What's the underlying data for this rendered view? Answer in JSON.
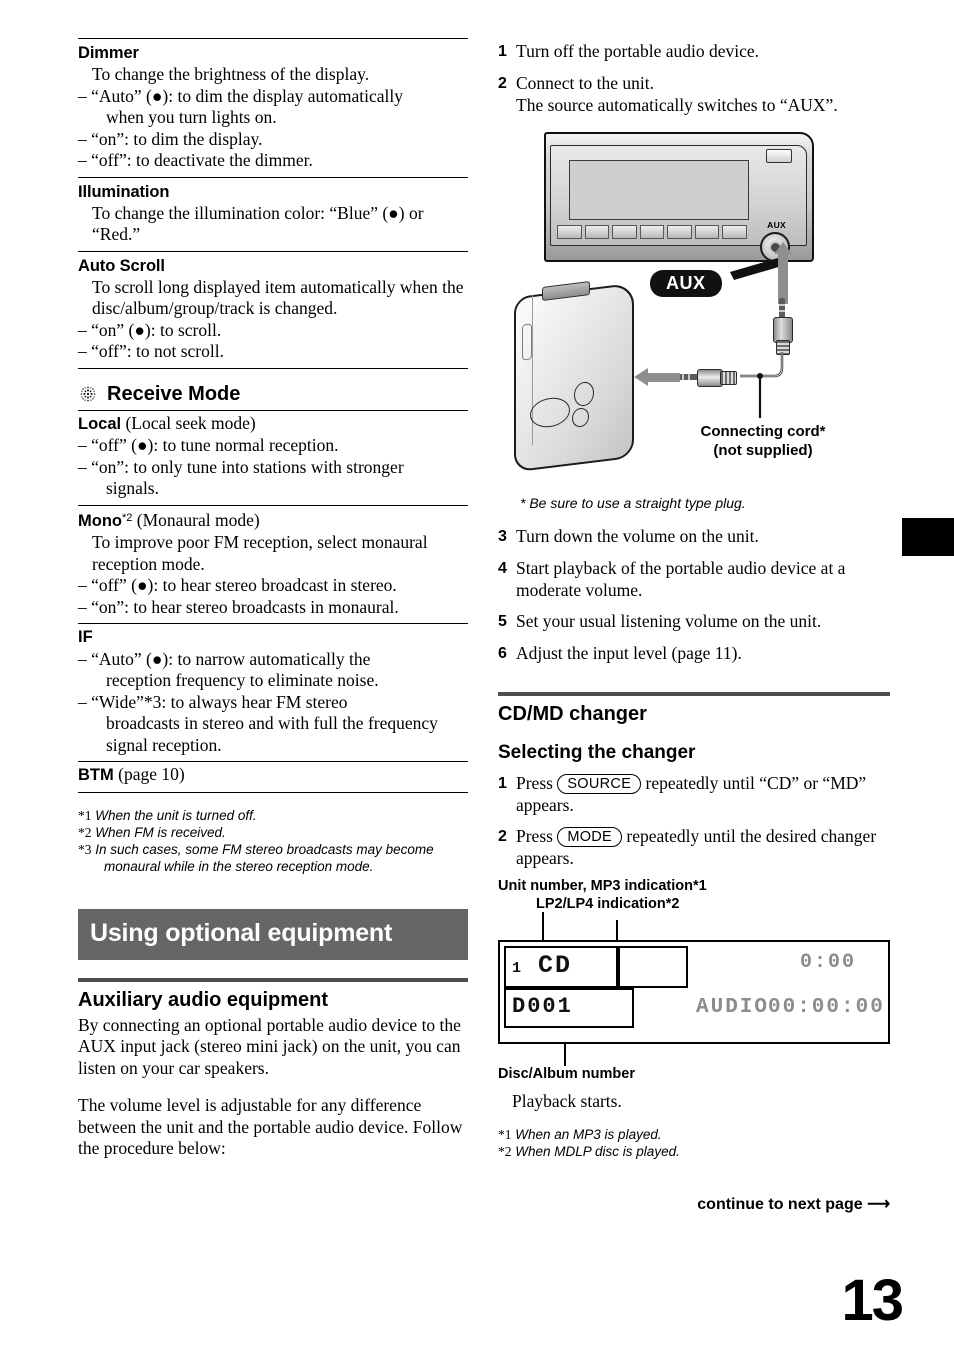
{
  "page": {
    "number": "13",
    "continue_label": "continue to next page",
    "continue_arrow": "arrow-right-icon"
  },
  "left_column": {
    "settings": [
      {
        "id": "dimmer",
        "title": "Dimmer",
        "description": "To change the brightness of the display.",
        "options": [
          {
            "text": "– “Auto” (●): to dim the display automatically",
            "cont": "when you turn lights on."
          },
          {
            "text": "– “on”: to dim the display.",
            "cont": ""
          },
          {
            "text": "– “off”: to deactivate the dimmer.",
            "cont": ""
          }
        ]
      },
      {
        "id": "illumination",
        "title": "Illumination",
        "description": "To change the illumination color: “Blue” (●) or “Red.”",
        "options": []
      },
      {
        "id": "auto-scroll",
        "title": "Auto Scroll",
        "description": "To scroll long displayed item automatically when the disc/album/group/track is changed.",
        "options": [
          {
            "text": "– “on” (●): to scroll.",
            "cont": ""
          },
          {
            "text": "– “off”: to not scroll.",
            "cont": ""
          }
        ]
      }
    ],
    "receive_mode": {
      "icon": "radio-wave-icon",
      "heading": "Receive Mode",
      "entries": [
        {
          "id": "local",
          "title": "Local",
          "title_suffix": " (Local seek mode)",
          "description": "",
          "options": [
            {
              "text": "– “off” (●): to tune normal reception.",
              "cont": ""
            },
            {
              "text": "– “on”: to only tune into stations with stronger",
              "cont": "signals."
            }
          ]
        },
        {
          "id": "mono",
          "title": "Mono",
          "title_footnote": "*2",
          "title_suffix": " (Monaural mode)",
          "description": "To improve poor FM reception, select monaural reception mode.",
          "options": [
            {
              "text": "– “off” (●): to hear stereo broadcast in stereo.",
              "cont": ""
            },
            {
              "text": "– “on”: to hear stereo broadcasts in monaural.",
              "cont": ""
            }
          ]
        },
        {
          "id": "if",
          "title": "IF",
          "title_suffix": "",
          "description": "",
          "options": [
            {
              "text": "– “Auto” (●): to narrow automatically the",
              "cont": "reception frequency to eliminate noise."
            },
            {
              "text": "– “Wide”*3: to always hear FM stereo",
              "cont": "broadcasts in stereo and with full the frequency signal reception."
            }
          ]
        },
        {
          "id": "btm",
          "title": "BTM",
          "title_suffix": " (page 10)",
          "description": "",
          "options": []
        }
      ]
    },
    "footnotes": [
      {
        "num": "*1",
        "text": "When the unit is turned off."
      },
      {
        "num": "*2",
        "text": "When FM is received."
      },
      {
        "num": "*3",
        "text": "In such cases, some FM stereo broadcasts may become monaural while in the stereo reception mode."
      }
    ],
    "chapter_title": "Using optional equipment",
    "aux_section": {
      "heading": "Auxiliary audio equipment",
      "paragraph1": "By connecting an optional portable audio device to the AUX input jack (stereo mini jack) on the unit, you can listen on your car speakers.",
      "paragraph2": "The volume level is adjustable for any difference between the unit and the portable audio device. Follow the procedure below:"
    }
  },
  "right_column": {
    "steps_top": [
      {
        "n": "1",
        "text": "Turn off the portable audio device.",
        "sub": ""
      },
      {
        "n": "2",
        "text": "Connect to the unit.",
        "sub": "The source automatically switches to “AUX”."
      }
    ],
    "illustration": {
      "aux_badge": "AUX",
      "aux_jack_label": "AUX",
      "cord_label_line1": "Connecting cord*",
      "cord_label_line2": "(not supplied)"
    },
    "illustration_note": "Be sure to use a straight type plug.",
    "illustration_note_marker": "*",
    "steps_bottom": [
      {
        "n": "3",
        "text": "Turn down the volume on the unit.",
        "sub": ""
      },
      {
        "n": "4",
        "text": "Start playback of the portable audio device at a moderate volume.",
        "sub": ""
      },
      {
        "n": "5",
        "text": "Set your usual listening volume on the unit.",
        "sub": ""
      },
      {
        "n": "6",
        "text": "Adjust the input level (page 11).",
        "sub": ""
      }
    ],
    "changer": {
      "heading": "CD/MD changer",
      "subheading": "Selecting the changer",
      "steps": [
        {
          "n": "1",
          "pre": "Press ",
          "button": "SOURCE",
          "post": " repeatedly until “CD” or “MD” appears."
        },
        {
          "n": "2",
          "pre": "Press ",
          "button": "MODE",
          "post": " repeatedly until the desired changer appears."
        }
      ],
      "display": {
        "label_top1": "Unit number, MP3 indication*1",
        "label_top2": "LP2/LP4 indication*2",
        "label_bottom": "Disc/Album number",
        "segments": {
          "unit_number": "1",
          "source": "CD",
          "disc_album": "D001",
          "track_label": "AUDIO",
          "clock": "0:00",
          "elapsed": "00:00:00"
        }
      },
      "playback_text": "Playback starts.",
      "footnotes": [
        {
          "num": "*1",
          "text": "When an MP3 is played."
        },
        {
          "num": "*2",
          "text": "When MDLP disc is played."
        }
      ]
    }
  }
}
